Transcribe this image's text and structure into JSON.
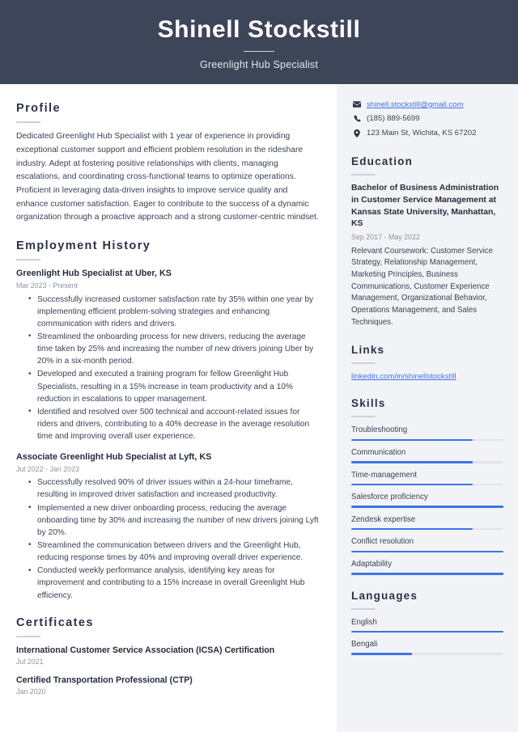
{
  "header": {
    "name": "Shinell Stockstill",
    "title": "Greenlight Hub Specialist"
  },
  "theme": {
    "header_bg": "#3d4558",
    "sidebar_bg": "#f2f3f6",
    "accent_blue": "#3d74e8",
    "text": "#3a4256",
    "muted": "#8d93a1"
  },
  "main": {
    "profile": {
      "heading": "Profile",
      "text": "Dedicated Greenlight Hub Specialist with 1 year of experience in providing exceptional customer support and efficient problem resolution in the rideshare industry. Adept at fostering positive relationships with clients, managing escalations, and coordinating cross-functional teams to optimize operations. Proficient in leveraging data-driven insights to improve service quality and enhance customer satisfaction. Eager to contribute to the success of a dynamic organization through a proactive approach and a strong customer-centric mindset."
    },
    "employment": {
      "heading": "Employment History",
      "jobs": [
        {
          "title": "Greenlight Hub Specialist at Uber, KS",
          "date": "Mar 2023 - Present",
          "bullets": [
            "Successfully increased customer satisfaction rate by 35% within one year by implementing efficient problem-solving strategies and enhancing communication with riders and drivers.",
            "Streamlined the onboarding process for new drivers, reducing the average time taken by 25% and increasing the number of new drivers joining Uber by 20% in a six-month period.",
            "Developed and executed a training program for fellow Greenlight Hub Specialists, resulting in a 15% increase in team productivity and a 10% reduction in escalations to upper management.",
            "Identified and resolved over 500 technical and account-related issues for riders and drivers, contributing to a 40% decrease in the average resolution time and improving overall user experience."
          ]
        },
        {
          "title": "Associate Greenlight Hub Specialist at Lyft, KS",
          "date": "Jul 2022 - Jan 2023",
          "bullets": [
            "Successfully resolved 90% of driver issues within a 24-hour timeframe, resulting in improved driver satisfaction and increased productivity.",
            "Implemented a new driver onboarding process, reducing the average onboarding time by 30% and increasing the number of new drivers joining Lyft by 20%.",
            "Streamlined the communication between drivers and the Greenlight Hub, reducing response times by 40% and improving overall driver experience.",
            "Conducted weekly performance analysis, identifying key areas for improvement and contributing to a 15% increase in overall Greenlight Hub efficiency."
          ]
        }
      ]
    },
    "certificates": {
      "heading": "Certificates",
      "items": [
        {
          "name": "International Customer Service Association (ICSA) Certification",
          "date": "Jul 2021"
        },
        {
          "name": "Certified Transportation Professional (CTP)",
          "date": "Jan 2020"
        }
      ]
    }
  },
  "sidebar": {
    "contact": [
      {
        "icon": "envelope-icon",
        "text": "shinell.stockstill@gmail.com",
        "is_link": true
      },
      {
        "icon": "phone-icon",
        "text": "(185) 889-5699",
        "is_link": false
      },
      {
        "icon": "map-pin-icon",
        "text": "123 Main St, Wichita, KS 67202",
        "is_link": false
      }
    ],
    "education": {
      "heading": "Education",
      "degree": "Bachelor of Business Administration in Customer Service Management at Kansas State University, Manhattan, KS",
      "date": "Sep 2017 - May 2022",
      "description": "Relevant Coursework: Customer Service Strategy, Relationship Management, Marketing Principles, Business Communications, Customer Experience Management, Organizational Behavior, Operations Management, and Sales Techniques."
    },
    "links": {
      "heading": "Links",
      "items": [
        {
          "text": "linkedin.com/in/shinellstockstill"
        }
      ]
    },
    "skills": {
      "heading": "Skills",
      "items": [
        {
          "label": "Troubleshooting",
          "level": 80
        },
        {
          "label": "Communication",
          "level": 80
        },
        {
          "label": "Time-management",
          "level": 80
        },
        {
          "label": "Salesforce proficiency",
          "level": 100
        },
        {
          "label": "Zendesk expertise",
          "level": 80
        },
        {
          "label": "Conflict resolution",
          "level": 100
        },
        {
          "label": "Adaptability",
          "level": 100
        }
      ]
    },
    "languages": {
      "heading": "Languages",
      "items": [
        {
          "label": "English",
          "level": 100
        },
        {
          "label": "Bengali",
          "level": 40
        }
      ]
    }
  }
}
